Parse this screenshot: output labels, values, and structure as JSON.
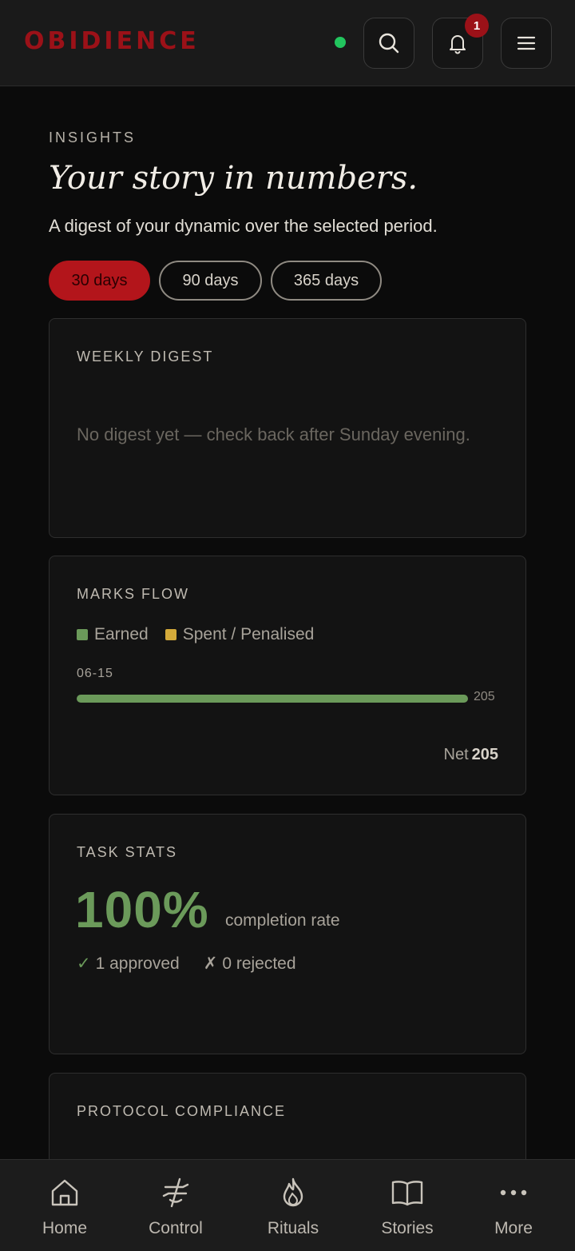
{
  "header": {
    "brand": "OBIDIENCE",
    "status_color": "#22c55e",
    "search_icon": "search-icon",
    "notification_count": "1",
    "notification_icon": "bell-icon",
    "menu_icon": "menu-icon"
  },
  "intro": {
    "eyebrow": "INSIGHTS",
    "headline": "Your story in numbers.",
    "subtitle": "A digest of your dynamic over the selected period."
  },
  "periods": [
    {
      "label": "30 days",
      "active": true
    },
    {
      "label": "90 days",
      "active": false
    },
    {
      "label": "365 days",
      "active": false
    }
  ],
  "weekly_digest": {
    "title": "WEEKLY DIGEST",
    "empty_message": "No digest yet — check back after Sunday evening."
  },
  "marks_flow": {
    "title": "MARKS FLOW",
    "legend": [
      {
        "label": "Earned",
        "color": "#6b9a5a"
      },
      {
        "label": "Spent / Penalised",
        "color": "#d4aa3a"
      }
    ],
    "rows": [
      {
        "date": "06-15",
        "earned": 205,
        "spent": 0,
        "label": "205"
      }
    ],
    "net_label": "Net",
    "net_value": "205"
  },
  "task_stats": {
    "title": "TASK STATS",
    "completion_rate": "100%",
    "completion_caption": "completion rate",
    "approved_mark": "✓",
    "approved_text": "1 approved",
    "rejected_mark": "✗",
    "rejected_text": "0 rejected"
  },
  "protocol_compliance": {
    "title": "PROTOCOL COMPLIANCE"
  },
  "bottom_nav": [
    {
      "label": "Home",
      "icon": "home-icon"
    },
    {
      "label": "Control",
      "icon": "control-icon"
    },
    {
      "label": "Rituals",
      "icon": "flame-icon"
    },
    {
      "label": "Stories",
      "icon": "book-icon"
    },
    {
      "label": "More",
      "icon": "more-icon"
    }
  ]
}
